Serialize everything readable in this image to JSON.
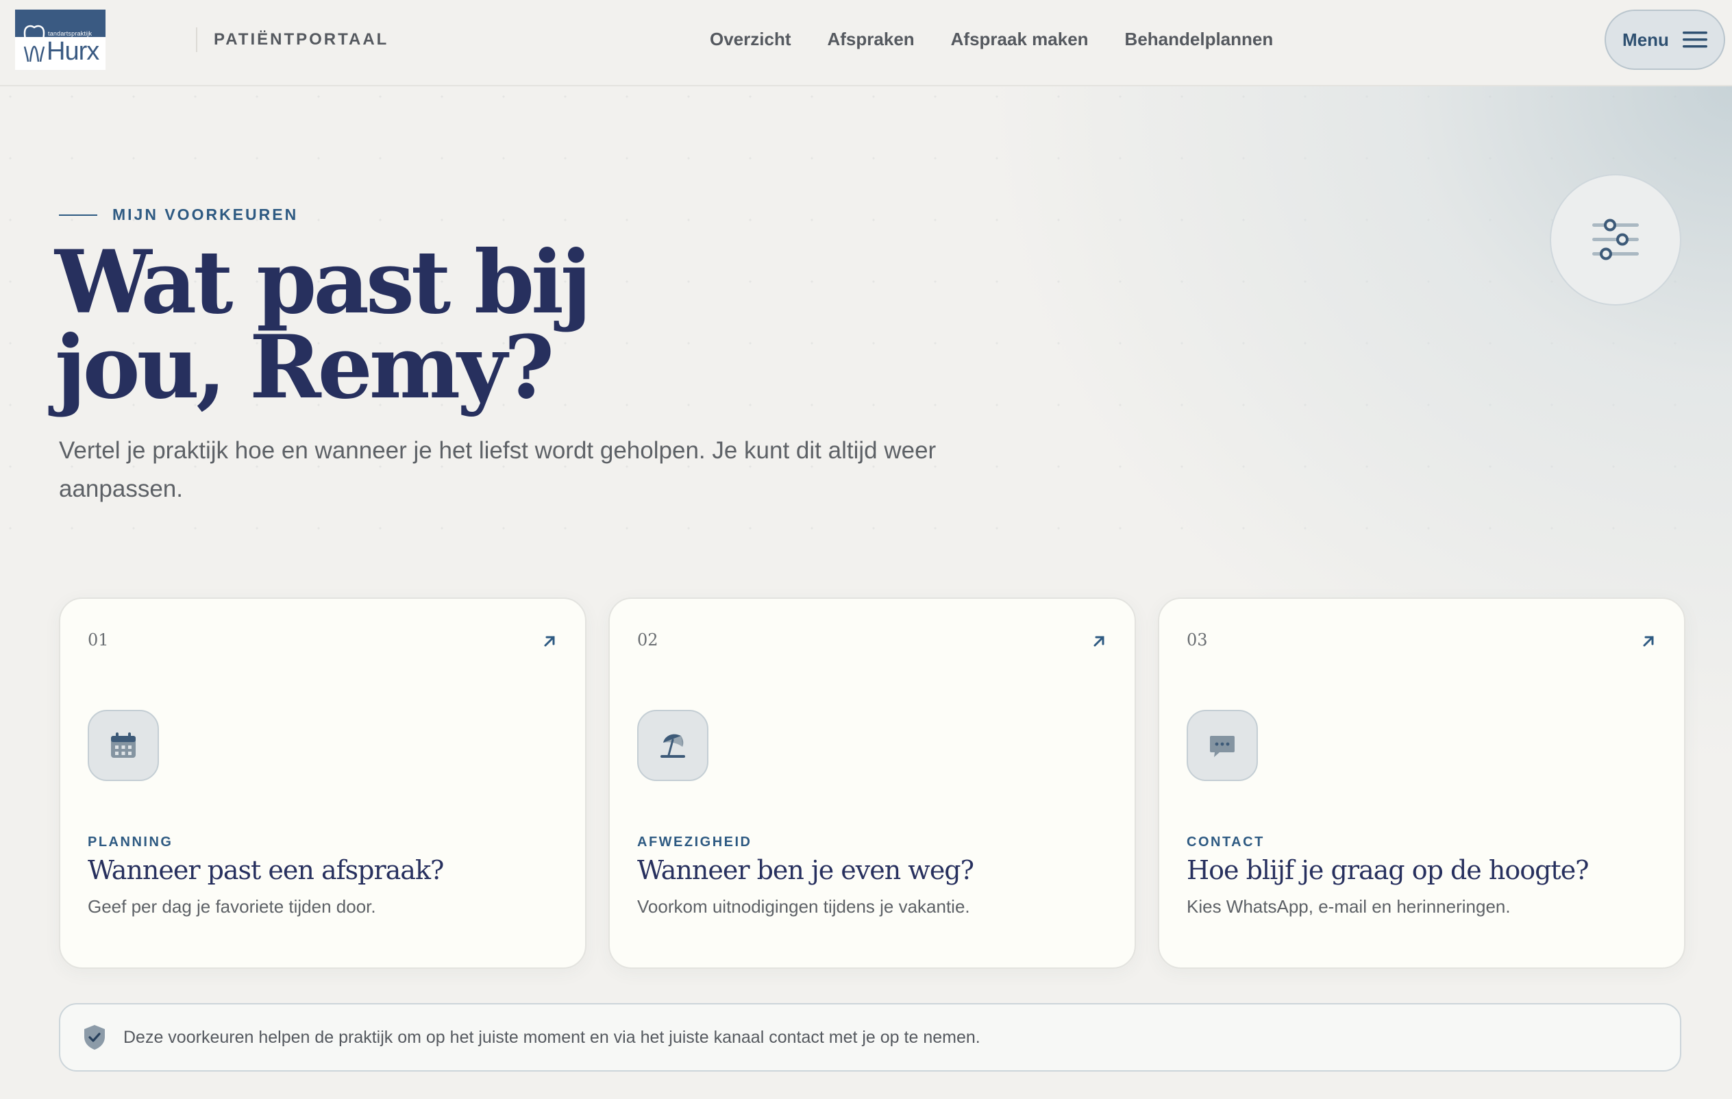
{
  "header": {
    "logo_small": "tandartspraktijk",
    "logo_word": "Hurx",
    "portal_label": "PATIËNTPORTAAL",
    "nav": [
      "Overzicht",
      "Afspraken",
      "Afspraak maken",
      "Behandelplannen"
    ],
    "menu_label": "Menu"
  },
  "hero": {
    "eyebrow": "MIJN VOORKEUREN",
    "title_line1": "Wat past bij",
    "title_line2": "jou, Remy?",
    "subtitle": "Vertel je praktijk hoe en wanneer je het liefst wordt geholpen. Je kunt dit altijd weer aanpassen."
  },
  "cards": [
    {
      "num": "01",
      "icon": "calendar-icon",
      "tag": "PLANNING",
      "title": "Wanneer past een afspraak?",
      "desc": "Geef per dag je favoriete tijden door."
    },
    {
      "num": "02",
      "icon": "beach-umbrella-icon",
      "tag": "AFWEZIGHEID",
      "title": "Wanneer ben je even weg?",
      "desc": "Voorkom uitnodigingen tijdens je vakantie."
    },
    {
      "num": "03",
      "icon": "chat-bubble-icon",
      "tag": "CONTACT",
      "title": "Hoe blijf je graag op de hoogte?",
      "desc": "Kies WhatsApp, e-mail en herinneringen."
    }
  ],
  "notice": {
    "icon": "shield-check-icon",
    "text": "Deze voorkeuren helpen de praktijk om op het juiste moment en via het juiste kanaal contact met je op te nemen."
  },
  "colors": {
    "accent": "#2e5a82",
    "heading": "#27305e",
    "background": "#f2f1ee",
    "card": "#fdfdf8"
  }
}
